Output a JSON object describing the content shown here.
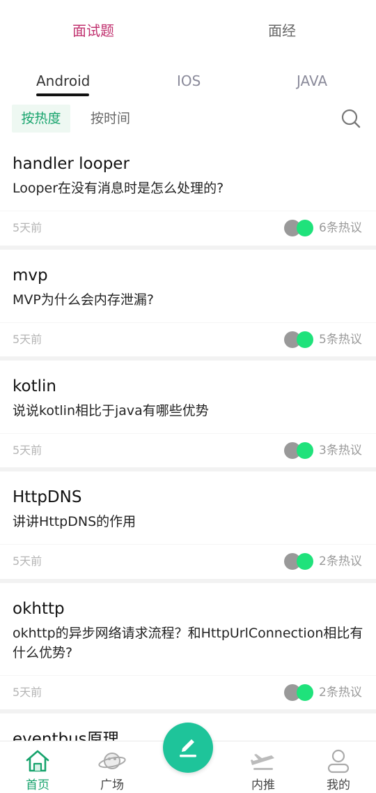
{
  "top_tabs": {
    "interview_questions": "面试题",
    "interview_experience": "面经"
  },
  "category_tabs": [
    "Android",
    "IOS",
    "JAVA"
  ],
  "sort": {
    "hot": "按热度",
    "time": "按时间"
  },
  "items": [
    {
      "title": "handler looper",
      "desc": "Looper在没有消息时是怎么处理的?",
      "time": "5天前",
      "comments": "6条热议"
    },
    {
      "title": "mvp",
      "desc": "MVP为什么会内存泄漏?",
      "time": "5天前",
      "comments": "5条热议"
    },
    {
      "title": "kotlin",
      "desc": "说说kotlin相比于java有哪些优势",
      "time": "5天前",
      "comments": "3条热议"
    },
    {
      "title": "HttpDNS",
      "desc": "讲讲HttpDNS的作用",
      "time": "5天前",
      "comments": "2条热议"
    },
    {
      "title": "okhttp",
      "desc": "okhttp的异步网络请求流程？和HttpUrlConnection相比有什么优势?",
      "time": "5天前",
      "comments": "2条热议"
    },
    {
      "title": "eventbus原理",
      "desc": "",
      "time": "",
      "comments": ""
    }
  ],
  "nav": {
    "home": "首页",
    "square": "广场",
    "referral": "内推",
    "mine": "我的"
  },
  "colors": {
    "accent": "#c0306e",
    "green": "#16a36c",
    "fab": "#1ec49a",
    "heat_dot": "#1fe27b"
  },
  "icons": [
    "search-icon",
    "home-icon",
    "planet-icon",
    "edit-icon",
    "airplane-icon",
    "user-icon"
  ]
}
